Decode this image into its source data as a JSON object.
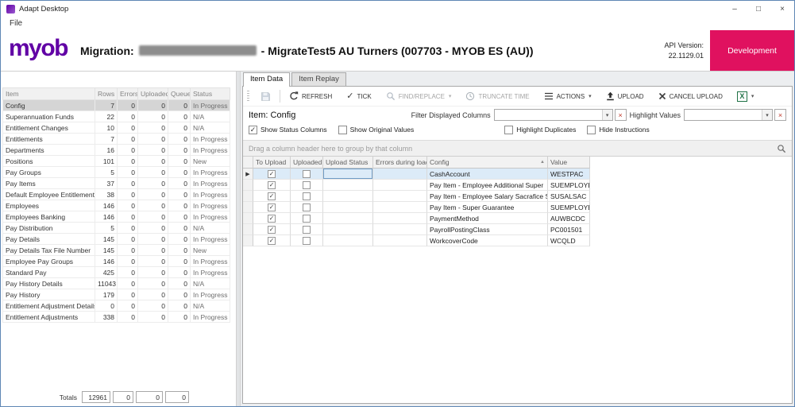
{
  "colors": {
    "brand_purple": "#6100A5",
    "development_pink": "#E0115F",
    "selected_row_blue": "#DCEBF8",
    "selected_item_gray": "#D5D5D5"
  },
  "icons": {
    "caret": "▾",
    "sort_asc": "▲",
    "row_arrow": "▶",
    "check": "✓",
    "tick": "✓",
    "clear": "×",
    "minimize": "–",
    "maximize": "□",
    "close": "×"
  },
  "window": {
    "title": "Adapt Desktop",
    "menu": {
      "file": "File"
    }
  },
  "header": {
    "logo_text": "myob",
    "migration_prefix": "Migration:",
    "migration_name_redacted": true,
    "migration_suffix": "- MigrateTest5 AU Turners (007703 - MYOB ES (AU))",
    "api_version_label": "API Version:",
    "api_version_value": "22.1129.01",
    "environment_button": "Development"
  },
  "item_table": {
    "columns": [
      "Item",
      "Rows",
      "Errors",
      "Uploaded",
      "Queued",
      "Status"
    ],
    "selected_index": 0,
    "rows": [
      [
        "Config",
        "7",
        "0",
        "0",
        "0",
        "In Progress"
      ],
      [
        "Superannuation Funds",
        "22",
        "0",
        "0",
        "0",
        "N/A"
      ],
      [
        "Entitlement Changes",
        "10",
        "0",
        "0",
        "0",
        "N/A"
      ],
      [
        "Entitlements",
        "7",
        "0",
        "0",
        "0",
        "In Progress"
      ],
      [
        "Departments",
        "16",
        "0",
        "0",
        "0",
        "In Progress"
      ],
      [
        "Positions",
        "101",
        "0",
        "0",
        "0",
        "New"
      ],
      [
        "Pay Groups",
        "5",
        "0",
        "0",
        "0",
        "In Progress"
      ],
      [
        "Pay Items",
        "37",
        "0",
        "0",
        "0",
        "In Progress"
      ],
      [
        "Default Employee Entitlements",
        "38",
        "0",
        "0",
        "0",
        "In Progress"
      ],
      [
        "Employees",
        "146",
        "0",
        "0",
        "0",
        "In Progress"
      ],
      [
        "Employees Banking",
        "146",
        "0",
        "0",
        "0",
        "In Progress"
      ],
      [
        "Pay Distribution",
        "5",
        "0",
        "0",
        "0",
        "N/A"
      ],
      [
        "Pay Details",
        "145",
        "0",
        "0",
        "0",
        "In Progress"
      ],
      [
        "Pay Details Tax File Number",
        "145",
        "0",
        "0",
        "0",
        "New"
      ],
      [
        "Employee Pay Groups",
        "146",
        "0",
        "0",
        "0",
        "In Progress"
      ],
      [
        "Standard Pay",
        "425",
        "0",
        "0",
        "0",
        "In Progress"
      ],
      [
        "Pay History Details",
        "11043",
        "0",
        "0",
        "0",
        "N/A"
      ],
      [
        "Pay History",
        "179",
        "0",
        "0",
        "0",
        "In Progress"
      ],
      [
        "Entitlement Adjustment Details",
        "0",
        "0",
        "0",
        "0",
        "N/A"
      ],
      [
        "Entitlement Adjustments",
        "338",
        "0",
        "0",
        "0",
        "In Progress"
      ]
    ],
    "totals": {
      "label": "Totals",
      "values": [
        "12961",
        "0",
        "0",
        "0"
      ]
    }
  },
  "tabs": [
    {
      "label": "Item Data",
      "active": true
    },
    {
      "label": "Item Replay",
      "active": false
    }
  ],
  "toolbar": {
    "buttons": [
      {
        "name": "save-button",
        "icon": "save",
        "label": "",
        "disabled": true,
        "separator_after": true
      },
      {
        "name": "refresh-button",
        "icon": "refresh",
        "label": "REFRESH"
      },
      {
        "name": "tick-button",
        "icon": "tick",
        "label": "TICK"
      },
      {
        "name": "find-replace-button",
        "icon": "search",
        "label": "FIND/REPLACE",
        "disabled": true,
        "dropdown": true
      },
      {
        "name": "truncate-time-button",
        "icon": "clock",
        "label": "TRUNCATE TIME",
        "disabled": true
      },
      {
        "name": "actions-button",
        "icon": "menu",
        "label": "ACTIONS",
        "dropdown": true
      },
      {
        "name": "upload-button",
        "icon": "upload",
        "label": "UPLOAD"
      },
      {
        "name": "cancel-upload-button",
        "icon": "cancel",
        "label": "CANCEL UPLOAD"
      },
      {
        "name": "export-excel-button",
        "icon": "excel",
        "label": "",
        "dropdown": true
      }
    ]
  },
  "filter_bar": {
    "item_label": "Item:",
    "item_value": "Config",
    "filter_columns_label": "Filter Displayed Columns",
    "filter_columns_value": "",
    "highlight_values_label": "Highlight Values",
    "highlight_values_value": ""
  },
  "options_row": {
    "checkboxes": [
      {
        "label": "Show Status Columns",
        "checked": true
      },
      {
        "label": "Show Original Values",
        "checked": false
      },
      {
        "label": "Highlight Duplicates",
        "checked": false
      },
      {
        "label": "Hide Instructions",
        "checked": false
      }
    ]
  },
  "group_panel": {
    "hint": "Drag a column header here to group by that column"
  },
  "grid": {
    "columns": [
      "To Upload",
      "Uploaded",
      "Upload Status",
      "Errors during load",
      "Config",
      "Value"
    ],
    "sort": {
      "column": "Config",
      "direction": "asc"
    },
    "current_row": 0,
    "focused_column": "Upload Status",
    "rows": [
      {
        "to_upload": true,
        "uploaded": false,
        "upload_status": "",
        "errors_during_load": "",
        "config": "CashAccount",
        "value": "WESTPAC"
      },
      {
        "to_upload": true,
        "uploaded": false,
        "upload_status": "",
        "errors_during_load": "",
        "config": "Pay Item - Employee Additional Super",
        "value": "SUEMPLOYEE"
      },
      {
        "to_upload": true,
        "uploaded": false,
        "upload_status": "",
        "errors_during_load": "",
        "config": "Pay Item - Employee Salary Sacrafice Super",
        "value": "SUSALSAC"
      },
      {
        "to_upload": true,
        "uploaded": false,
        "upload_status": "",
        "errors_during_load": "",
        "config": "Pay Item - Super Guarantee",
        "value": "SUEMPLOYER"
      },
      {
        "to_upload": true,
        "uploaded": false,
        "upload_status": "",
        "errors_during_load": "",
        "config": "PaymentMethod",
        "value": "AUWBCDC"
      },
      {
        "to_upload": true,
        "uploaded": false,
        "upload_status": "",
        "errors_during_load": "",
        "config": "PayrollPostingClass",
        "value": "PC001501"
      },
      {
        "to_upload": true,
        "uploaded": false,
        "upload_status": "",
        "errors_during_load": "",
        "config": "WorkcoverCode",
        "value": "WCQLD"
      }
    ]
  }
}
